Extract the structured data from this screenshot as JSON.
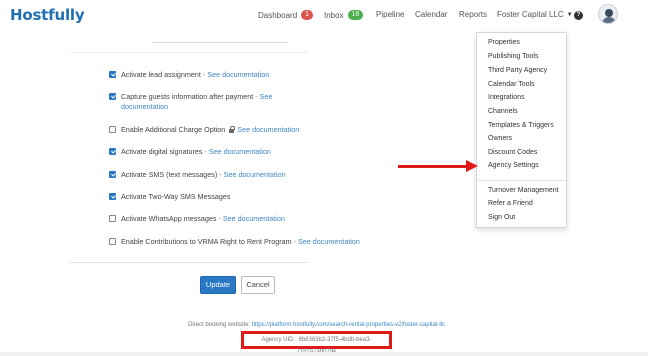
{
  "header": {
    "logo": "Hostfully",
    "nav": {
      "dashboard": "Dashboard",
      "dashboard_badge": "1",
      "inbox": "Inbox",
      "inbox_badge": "16",
      "pipeline": "Pipeline",
      "calendar": "Calendar",
      "reports": "Reports",
      "account": "Foster Capital LLC",
      "account_caret": "▼",
      "help": "?"
    }
  },
  "settings": {
    "separator": " - ",
    "doc_link": "See documentation",
    "options": [
      {
        "label": "Activate lead assignment",
        "checked": true
      },
      {
        "label": "Capture guests information after payment",
        "checked": true
      },
      {
        "label": "Enable Additional Charge Option",
        "checked": false
      },
      {
        "label": "Activate digital signatures",
        "checked": true
      },
      {
        "label": "Activate SMS (text messages)",
        "checked": true
      },
      {
        "label": "Activate Two-Way SMS Messages",
        "checked": true
      },
      {
        "label": "Activate WhatsApp messages",
        "checked": false
      },
      {
        "label": "Enable Contributions to VRMA Right to Rent Program",
        "checked": false
      }
    ],
    "doc_part2": "documentation"
  },
  "actions": {
    "update": "Update",
    "cancel": "Cancel"
  },
  "footer": {
    "booking_label": "Direct booking website:",
    "booking_url": "https://platform.hostfully.com/search-rental-properties-v2/foster-capital-llc",
    "agency_uid": "Agency UID : 6b8363b2-37f5-4bdb-bea3-7182a7ab079e"
  },
  "dropdown": {
    "items": [
      "Properties",
      "Publishing Tools",
      "Third Party Agency",
      "Calendar Tools",
      "Integrations",
      "Channels",
      "Templates & Triggers",
      "Owners",
      "Discount Codes",
      "Agency Settings",
      "Turnover Management",
      "Refer a Friend",
      "Sign Out"
    ]
  },
  "colors": {
    "brand": "#1f6fb2",
    "link": "#3d86c6",
    "highlight": "#e0191b",
    "badge_red": "#d9534f",
    "badge_green": "#4cae4c"
  }
}
